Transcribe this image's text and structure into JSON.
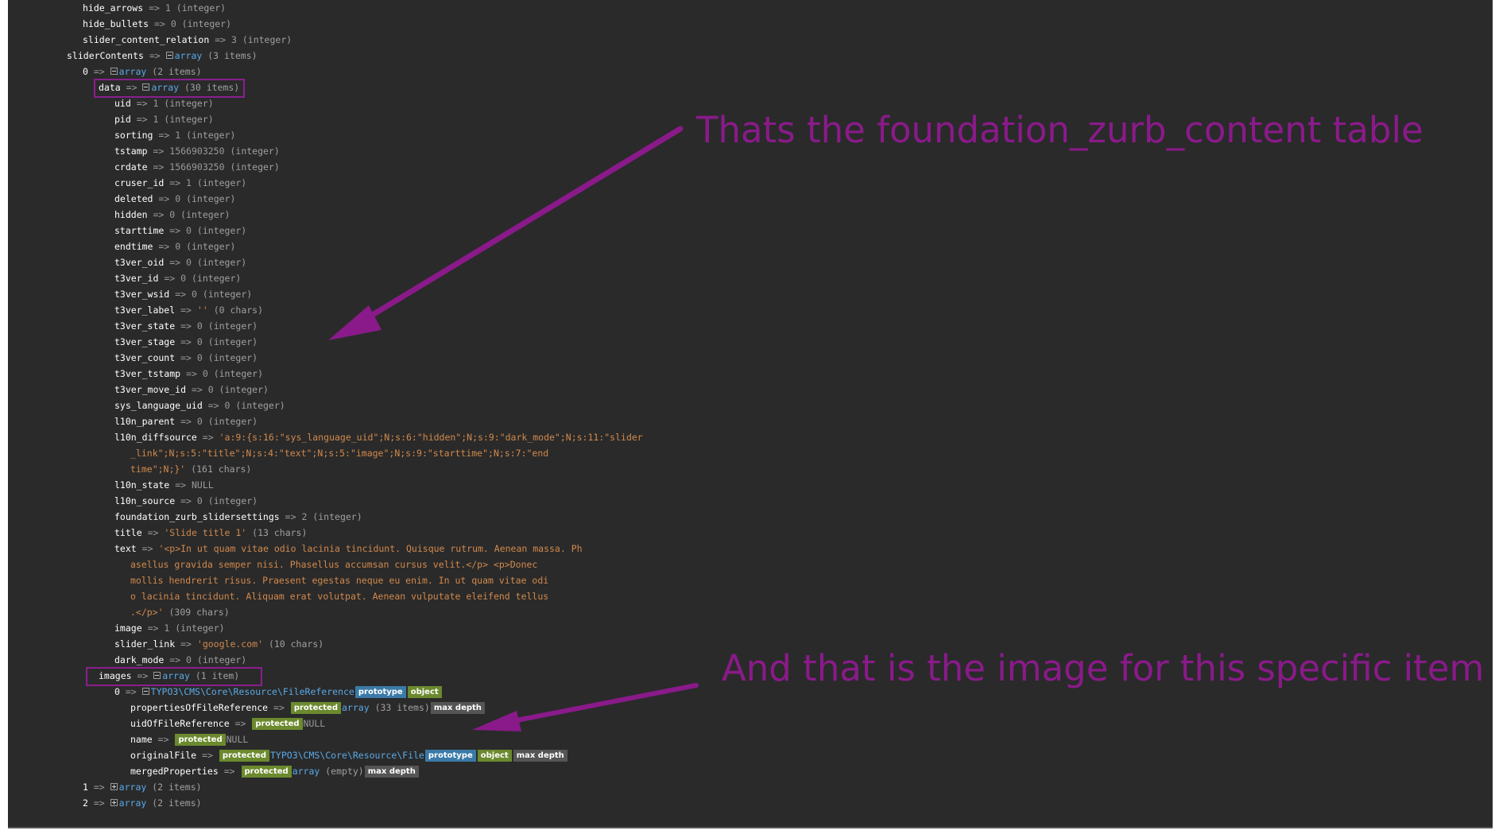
{
  "rows": [
    {
      "key": "hide_arrows",
      "val": "1",
      "type": "(integer)",
      "kind": "int"
    },
    {
      "key": "hide_bullets",
      "val": "0",
      "type": "(integer)",
      "kind": "int"
    },
    {
      "key": "slider_content_relation",
      "val": "3",
      "type": "(integer)",
      "kind": "int"
    },
    {
      "key": "sliderContents",
      "val": "array",
      "type": "(3 items)",
      "kind": "arr"
    },
    {
      "key": "0",
      "val": "array",
      "type": "(2 items)",
      "kind": "arr"
    },
    {
      "key": "data",
      "val": "array",
      "type": "(30 items)",
      "kind": "arr"
    },
    {
      "key": "uid",
      "val": "1",
      "type": "(integer)",
      "kind": "int"
    },
    {
      "key": "pid",
      "val": "1",
      "type": "(integer)",
      "kind": "int"
    },
    {
      "key": "sorting",
      "val": "1",
      "type": "(integer)",
      "kind": "int"
    },
    {
      "key": "tstamp",
      "val": "1566903250",
      "type": "(integer)",
      "kind": "int"
    },
    {
      "key": "crdate",
      "val": "1566903250",
      "type": "(integer)",
      "kind": "int"
    },
    {
      "key": "cruser_id",
      "val": "1",
      "type": "(integer)",
      "kind": "int"
    },
    {
      "key": "deleted",
      "val": "0",
      "type": "(integer)",
      "kind": "int"
    },
    {
      "key": "hidden",
      "val": "0",
      "type": "(integer)",
      "kind": "int"
    },
    {
      "key": "starttime",
      "val": "0",
      "type": "(integer)",
      "kind": "int"
    },
    {
      "key": "endtime",
      "val": "0",
      "type": "(integer)",
      "kind": "int"
    },
    {
      "key": "t3ver_oid",
      "val": "0",
      "type": "(integer)",
      "kind": "int"
    },
    {
      "key": "t3ver_id",
      "val": "0",
      "type": "(integer)",
      "kind": "int"
    },
    {
      "key": "t3ver_wsid",
      "val": "0",
      "type": "(integer)",
      "kind": "int"
    },
    {
      "key": "t3ver_label",
      "val": "''",
      "type": "(0 chars)",
      "kind": "int"
    },
    {
      "key": "t3ver_state",
      "val": "0",
      "type": "(integer)",
      "kind": "int"
    },
    {
      "key": "t3ver_stage",
      "val": "0",
      "type": "(integer)",
      "kind": "int"
    },
    {
      "key": "t3ver_count",
      "val": "0",
      "type": "(integer)",
      "kind": "int"
    },
    {
      "key": "t3ver_tstamp",
      "val": "0",
      "type": "(integer)",
      "kind": "int"
    },
    {
      "key": "t3ver_move_id",
      "val": "0",
      "type": "(integer)",
      "kind": "int"
    },
    {
      "key": "sys_language_uid",
      "val": "0",
      "type": "(integer)",
      "kind": "int"
    },
    {
      "key": "l10n_parent",
      "val": "0",
      "type": "(integer)",
      "kind": "int"
    },
    {
      "key": "l10n_diffsource",
      "val": "'a:9:{s:16:\"sys_language_uid\";N;s:6:\"hidden\";N;s:9:\"dark_mode\";N;s:11:\"slider",
      "type": "",
      "kind": "str"
    },
    {
      "key": "",
      "val": "_link\";N;s:5:\"title\";N;s:4:\"text\";N;s:5:\"image\";N;s:9:\"starttime\";N;s:7:\"end",
      "type": "",
      "kind": "cont"
    },
    {
      "key": "",
      "val": "time\";N;}'",
      "type": "(161 chars)",
      "kind": "cont"
    },
    {
      "key": "l10n_state",
      "val": "NULL",
      "type": "",
      "kind": "null"
    },
    {
      "key": "l10n_source",
      "val": "0",
      "type": "(integer)",
      "kind": "int"
    },
    {
      "key": "foundation_zurb_slidersettings",
      "val": "2",
      "type": "(integer)",
      "kind": "int"
    },
    {
      "key": "title",
      "val": "'Slide title 1'",
      "type": "(13 chars)",
      "kind": "str"
    },
    {
      "key": "text",
      "val": "'<p>In ut quam vitae odio lacinia tincidunt. Quisque rutrum. Aenean massa. Ph",
      "type": "",
      "kind": "str"
    },
    {
      "key": "",
      "val": "asellus gravida semper nisi. Phasellus accumsan cursus velit.</p> <p>Donec",
      "type": "",
      "kind": "cont"
    },
    {
      "key": "",
      "val": "mollis hendrerit risus. Praesent egestas neque eu enim. In ut quam vitae odi",
      "type": "",
      "kind": "cont"
    },
    {
      "key": "",
      "val": "o lacinia tincidunt. Aliquam erat volutpat. Aenean vulputate eleifend tellus",
      "type": "",
      "kind": "cont"
    },
    {
      "key": "",
      "val": ".</p>'",
      "type": "(309 chars)",
      "kind": "cont"
    },
    {
      "key": "image",
      "val": "1",
      "type": "(integer)",
      "kind": "int"
    },
    {
      "key": "slider_link",
      "val": "'google.com'",
      "type": "(10 chars)",
      "kind": "str"
    },
    {
      "key": "dark_mode",
      "val": "0",
      "type": "(integer)",
      "kind": "int"
    },
    {
      "key": "images",
      "val": "array",
      "type": "(1 item)",
      "kind": "arr"
    },
    {
      "key": "0",
      "val": "TYPO3\\CMS\\Core\\Resource\\FileReference",
      "type": "",
      "kind": "obj"
    },
    {
      "key": "propertiesOfFileReference",
      "val": "array",
      "type": "(33 items)",
      "kind": "prot"
    },
    {
      "key": "uidOfFileReference",
      "val": "NULL",
      "type": "",
      "kind": "protnull"
    },
    {
      "key": "name",
      "val": "NULL",
      "type": "",
      "kind": "protnull"
    },
    {
      "key": "originalFile",
      "val": "TYPO3\\CMS\\Core\\Resource\\File",
      "type": "",
      "kind": "protobj"
    },
    {
      "key": "mergedProperties",
      "val": "array",
      "type": "(empty)",
      "kind": "prot"
    },
    {
      "key": "1",
      "val": "array",
      "type": "(2 items)",
      "kind": "arr"
    },
    {
      "key": "2",
      "val": "array",
      "type": "(2 items)",
      "kind": "arr"
    }
  ],
  "arrow_symbol": "=>",
  "badges": {
    "protected": "protected",
    "prototype": "prototype",
    "object": "object",
    "max_depth": "max depth"
  },
  "annotations": {
    "top": "Thats the foundation_zurb_content table",
    "bottom": "And that is the image for this specific item"
  },
  "colors": {
    "background": "#2a2a2a",
    "annotation": "#8a1a8a",
    "string": "#d1894d",
    "keyword": "#5aa9e6"
  }
}
